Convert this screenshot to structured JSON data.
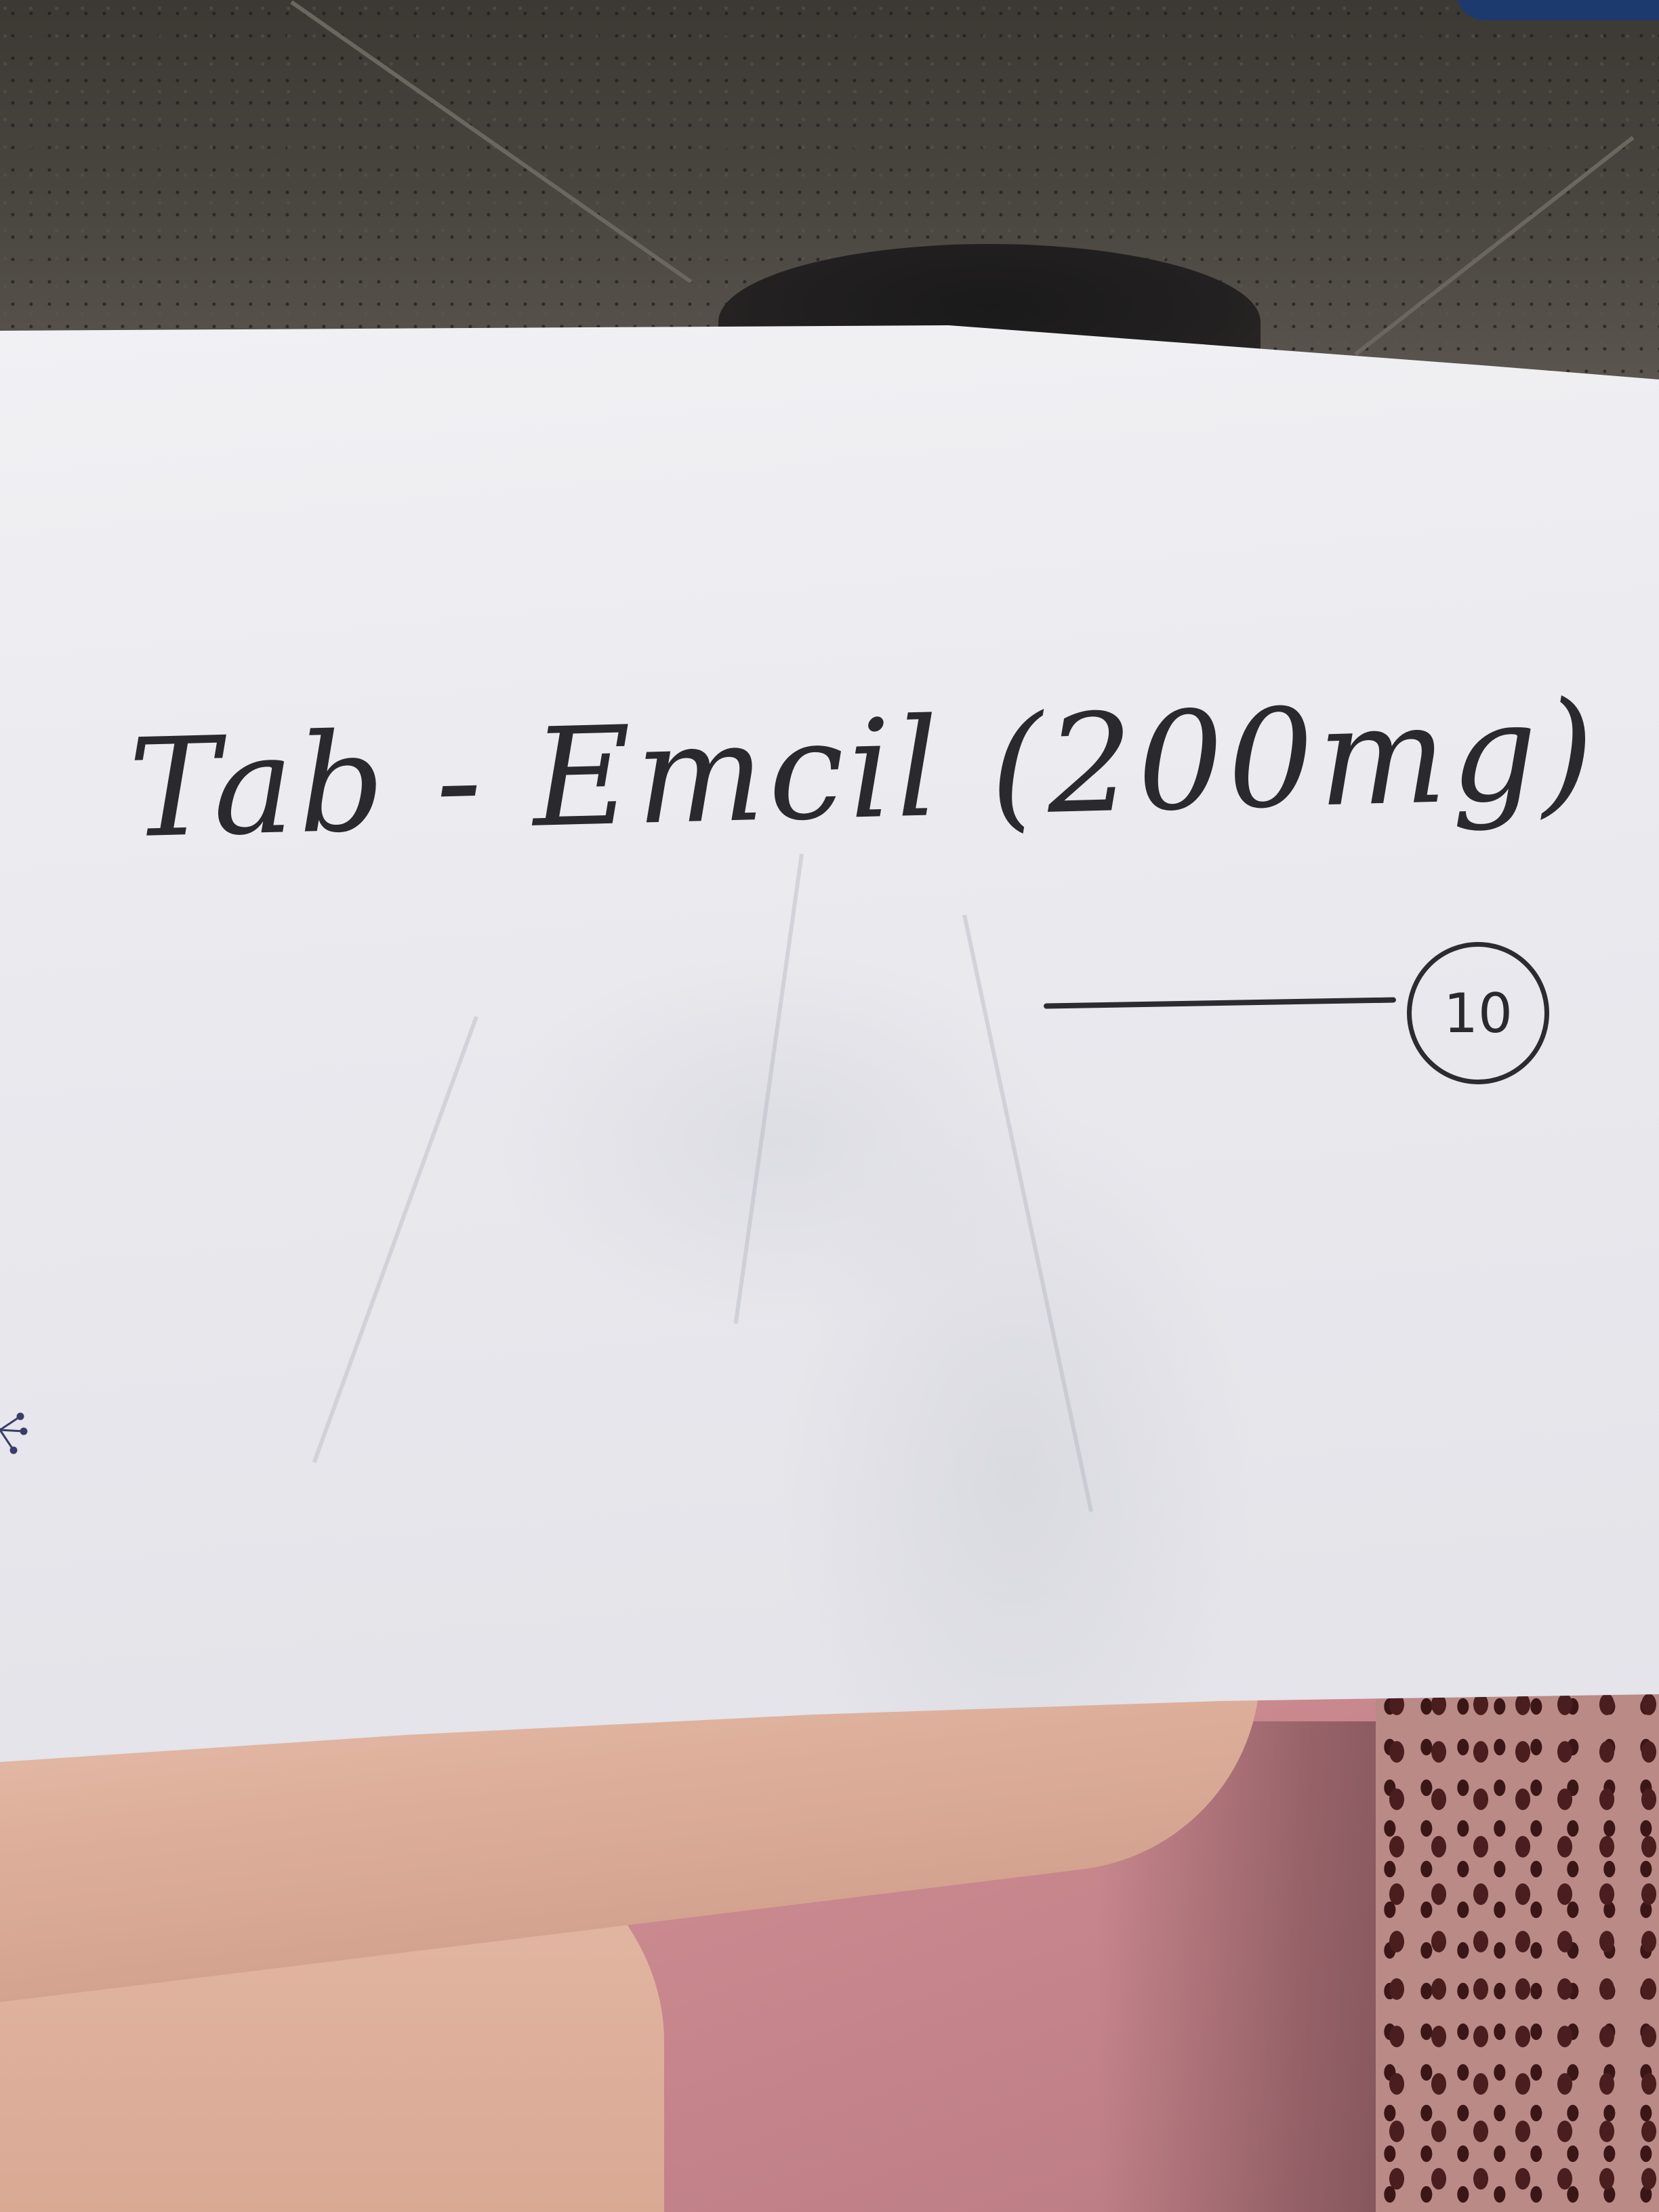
{
  "note": {
    "handwritten_line": "Tab - Emcil (200mg)",
    "quantity_circled": "10"
  },
  "colors": {
    "paper": "#ececf0",
    "ink": "#2a2a2e",
    "cloth": "#c9878e",
    "skin": "#dfb29e",
    "floor": "#4a4640"
  },
  "icons": {
    "quantity": "circled-number-icon"
  }
}
